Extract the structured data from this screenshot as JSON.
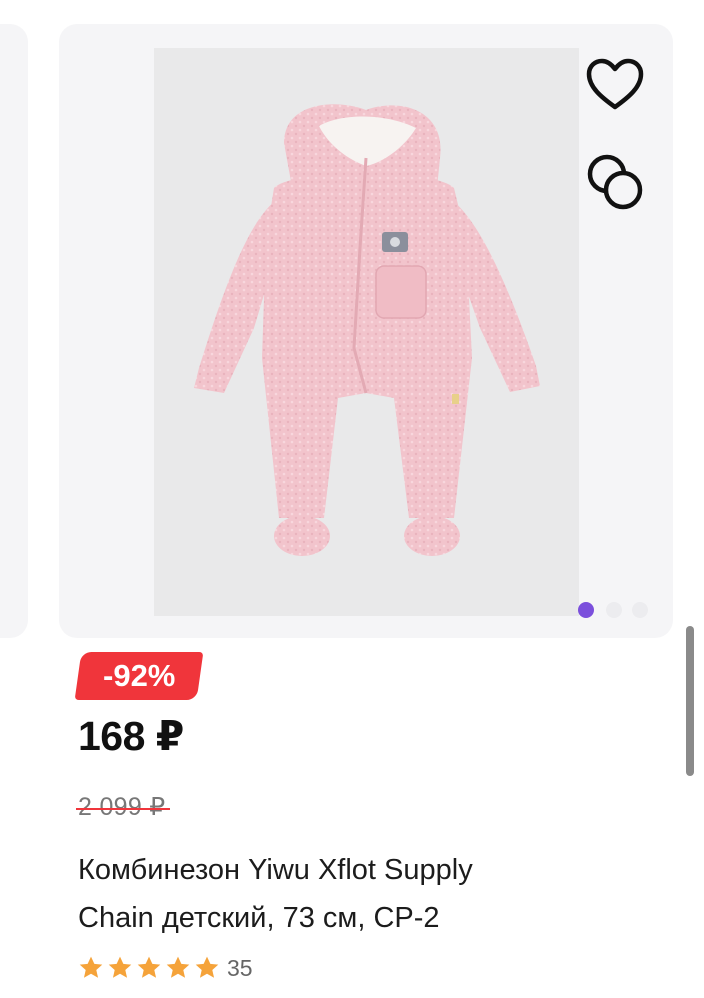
{
  "product": {
    "discount_badge": "-92%",
    "price": "168 ₽",
    "old_price": "2 099 ₽",
    "title_line1": "Комбинезон Yiwu Xflot Supply",
    "title_line2": "Chain детский, 73 см, СР-2",
    "rating": 5,
    "reviews_count": "35",
    "image_description": "pink-fleece-baby-jumpsuit-photo"
  },
  "gallery": {
    "dots": 3,
    "active_dot": 1
  },
  "icons": {
    "favorite": "heart-outline-icon",
    "compare": "compare-circles-icon",
    "star": "star-icon"
  },
  "colors": {
    "badge": "#f0353b",
    "active_dot": "#7b4fdc",
    "star": "#f5a33a",
    "card_bg": "#f5f5f7"
  }
}
